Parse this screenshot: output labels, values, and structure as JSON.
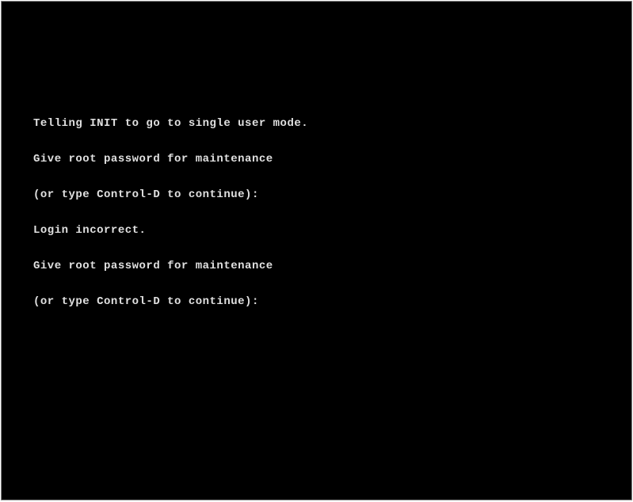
{
  "terminal": {
    "lines": [
      "Telling INIT to go to single user mode.",
      "Give root password for maintenance",
      "(or type Control-D to continue):",
      "Login incorrect.",
      "Give root password for maintenance",
      "(or type Control-D to continue):"
    ]
  }
}
